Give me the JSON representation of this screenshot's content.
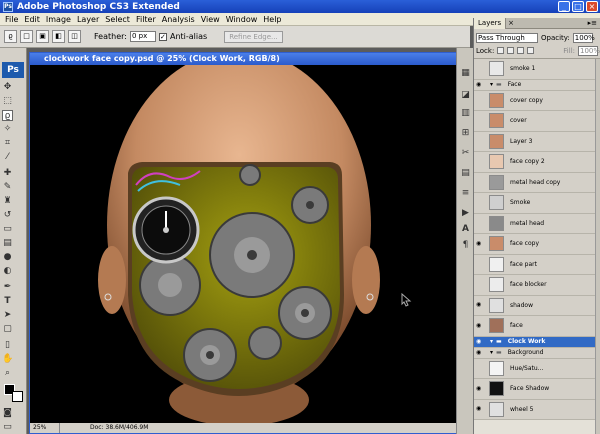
{
  "app": {
    "title": "Adobe Photoshop CS3 Extended",
    "icon": "ps-app-icon"
  },
  "menu": [
    "File",
    "Edit",
    "Image",
    "Layer",
    "Select",
    "Filter",
    "Analysis",
    "View",
    "Window",
    "Help"
  ],
  "options_bar": {
    "feather_label": "Feather:",
    "feather_value": "0 px",
    "antialias_label": "Anti-alias",
    "refine_edge_label": "Refine Edge..."
  },
  "toolbox": {
    "badge": "Ps"
  },
  "document": {
    "title": "clockwork face copy.psd @ 25% (Clock Work, RGB/8)",
    "zoom": "25%",
    "doc_info": "Doc: 38.6M/406.9M"
  },
  "layers_panel": {
    "tab": "Layers",
    "blend_mode": "Pass Through",
    "opacity_label": "Opacity:",
    "opacity_value": "100%",
    "lock_label": "Lock:",
    "fill_label": "Fill:",
    "fill_value": "100%",
    "layers": [
      {
        "name": "smoke 1",
        "type": "layer",
        "visible": false
      },
      {
        "name": "Face",
        "type": "folder",
        "visible": true
      },
      {
        "name": "cover copy",
        "type": "layer",
        "visible": false
      },
      {
        "name": "cover",
        "type": "layer",
        "visible": false
      },
      {
        "name": "Layer 3",
        "type": "layer",
        "visible": false
      },
      {
        "name": "face copy 2",
        "type": "layer",
        "visible": false
      },
      {
        "name": "metal head copy",
        "type": "layer",
        "visible": false
      },
      {
        "name": "Smoke",
        "type": "layer",
        "visible": false
      },
      {
        "name": "metal head",
        "type": "layer",
        "visible": false
      },
      {
        "name": "face copy",
        "type": "layer",
        "visible": true
      },
      {
        "name": "face part",
        "type": "layer",
        "visible": false
      },
      {
        "name": "face blocker",
        "type": "layer",
        "visible": false
      },
      {
        "name": "shadow",
        "type": "layer",
        "visible": true
      },
      {
        "name": "face",
        "type": "layer",
        "visible": true
      },
      {
        "name": "Clock Work",
        "type": "folder",
        "visible": true,
        "selected": true
      },
      {
        "name": "Background",
        "type": "folder",
        "visible": true
      },
      {
        "name": "Hue/Satu...",
        "type": "layer",
        "visible": false
      },
      {
        "name": "Face Shadow",
        "type": "layer",
        "visible": true
      },
      {
        "name": "wheel 5",
        "type": "layer",
        "visible": true
      }
    ]
  },
  "colors": {
    "accent": "#316ac5",
    "titlebar": "#1f4fcf",
    "background": "#000000",
    "skin": "#c8926a",
    "olive": "#8a8a0a"
  }
}
